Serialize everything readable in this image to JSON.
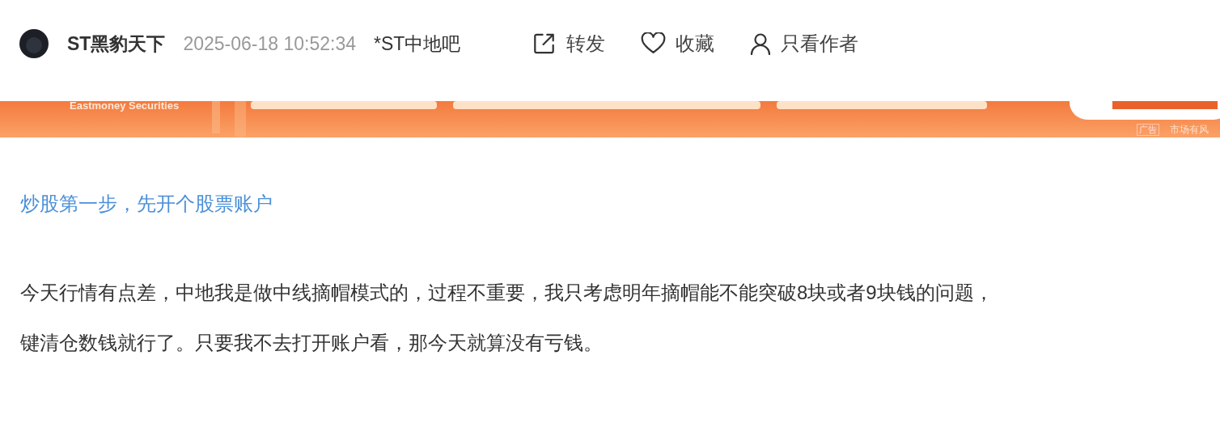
{
  "post_header": {
    "author": "ST黑豹天下",
    "time": "2025-06-18 10:52:34",
    "forum": "*ST中地吧",
    "actions": [
      {
        "kind": "share",
        "label": "转发"
      },
      {
        "kind": "favorite",
        "label": "收藏"
      },
      {
        "kind": "author_only",
        "label": "只看作者"
      }
    ]
  },
  "ad_banner": {
    "kind": "picture",
    "brand": "Eastmoney Securities",
    "tag": "广告",
    "notice": "市场有风"
  },
  "promo_link": "炒股第一步，先开个股票账户",
  "body_lines": [
    "今天行情有点差，中地我是做中线摘帽模式的，过程不重要，我只考虑明年摘帽能不能突破8块或者9块钱的问题，",
    "键清仓数钱就行了。只要我不去打开账户看，那今天就算没有亏钱。"
  ]
}
